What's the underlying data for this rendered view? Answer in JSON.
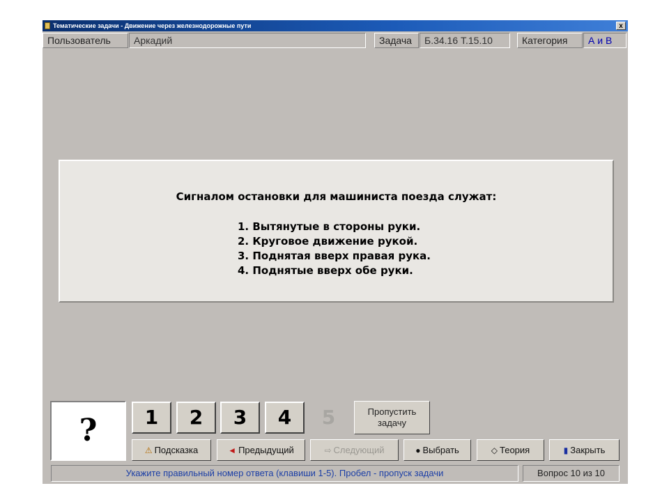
{
  "window": {
    "title": "Тематические задачи - Движение через железнодорожные пути",
    "close_symbol": "x"
  },
  "infobar": {
    "user_label": "Пользователь",
    "user_value": "Аркадий",
    "task_label": "Задача",
    "task_value": "Б.34.16  Т.15.10",
    "category_label": "Категория",
    "category_value": "А и В"
  },
  "question": {
    "text": "Сигналом остановки для машиниста поезда служат:",
    "answers": [
      "1. Вытянутые в стороны руки.",
      "2. Круговое движение рукой.",
      "3. Поднятая вверх правая рука.",
      "4. Поднятые вверх обе руки."
    ]
  },
  "answer_box": {
    "symbol": "?"
  },
  "number_buttons": [
    "1",
    "2",
    "3",
    "4",
    "5"
  ],
  "skip_button": {
    "line1": "Пропустить",
    "line2": "задачу"
  },
  "toolbar": {
    "hint": "Подсказка",
    "prev": "Предыдущий",
    "next": "Следующий",
    "choose": "Выбрать",
    "theory": "Теория",
    "close": "Закрыть"
  },
  "icons": {
    "hint": "warning-triangle-icon",
    "prev": "arrow-left-icon",
    "next": "arrow-right-icon",
    "choose": "stamp-icon",
    "theory": "diamond-icon",
    "close": "door-icon"
  },
  "statusbar": {
    "message": "Укажите правильный номер ответа (клавиши 1-5). Пробел - пропуск задачи",
    "progress": "Вопрос 10 из 10"
  },
  "colors": {
    "title_bar": "#0a2f6e",
    "window_bg": "#c0bcb8",
    "question_panel": "#e9e7e3",
    "status_text": "#1c3fa6",
    "category_value": "#0000b0"
  }
}
